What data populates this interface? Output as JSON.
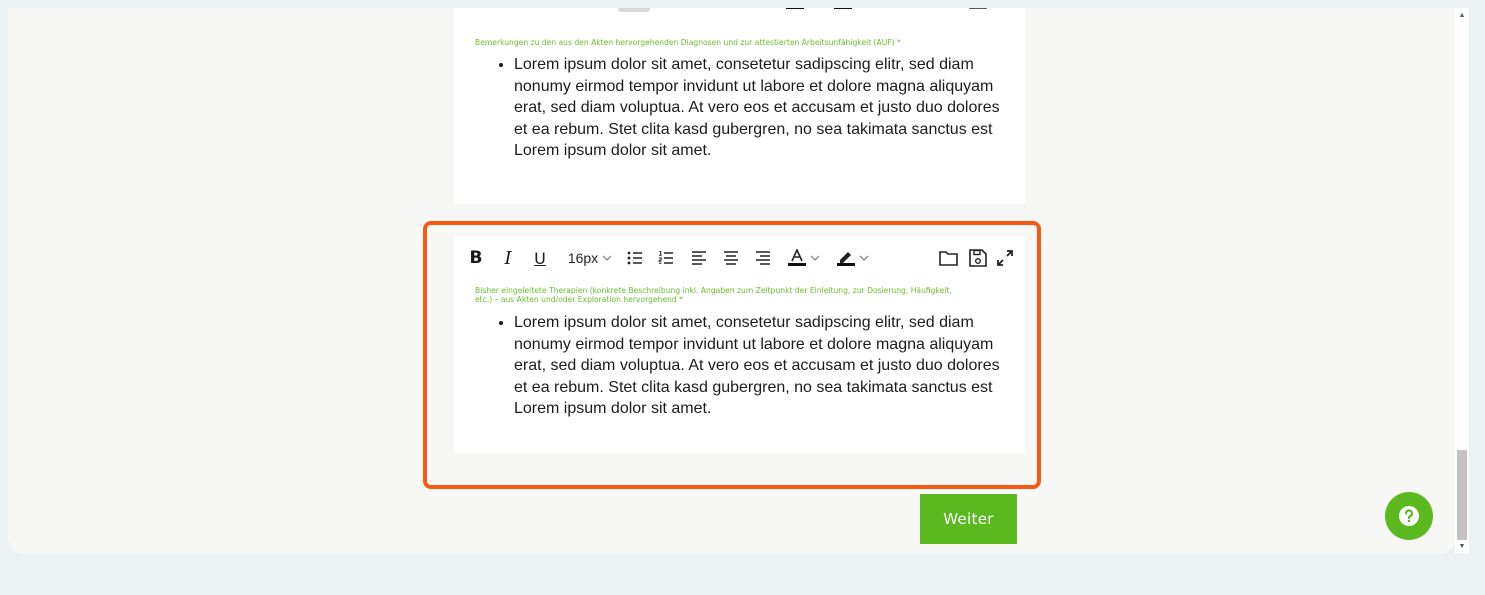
{
  "editor1": {
    "label": "Bemerkungen zu den aus den Akten hervorgehenden Diagnosen und zur attestierten Arbeitsunfähigkeit (AUF) *",
    "bullet": "Lorem ipsum dolor sit amet, consetetur sadipscing elitr, sed diam nonumy eirmod tempor invidunt ut labore et dolore magna aliquyam erat, sed diam voluptua. At vero eos et accusam et justo duo dolores et ea rebum. Stet clita kasd gubergren, no sea takimata sanctus est Lorem ipsum dolor sit amet."
  },
  "editor2": {
    "toolbar": {
      "bold": "B",
      "italic": "I",
      "underline": "U",
      "font_size": "16px"
    },
    "label": "Bisher eingeleitete Therapien (konkrete Beschreibung inkl. Angaben zum Zeitpunkt der Einleitung, zur Dosierung, Häufigkeit, etc.) – aus Akten und/oder Exploration hervorgehend *",
    "bullet": "Lorem ipsum dolor sit amet, consetetur sadipscing elitr, sed diam nonumy eirmod tempor invidunt ut labore et dolore magna aliquyam erat, sed diam voluptua. At vero eos et accusam et justo duo dolores et ea rebum. Stet clita kasd gubergren, no sea takimata sanctus est Lorem ipsum dolor sit amet."
  },
  "actions": {
    "next_label": "Weiter"
  },
  "colors": {
    "accent_green": "#5bb81e",
    "label_green": "#6cbd2a",
    "highlight_orange": "#f65a12",
    "page_background": "#ecf1f4"
  },
  "icons": {
    "bullet_list": "bullet-list-icon",
    "numbered_list": "numbered-list-icon",
    "align_left": "align-left-icon",
    "align_center": "align-center-icon",
    "align_right": "align-right-icon",
    "text_color": "text-color-icon",
    "highlight": "highlight-color-icon",
    "open_folder": "folder-open-icon",
    "save": "save-icon",
    "fullscreen": "fullscreen-icon",
    "help": "help-icon"
  }
}
